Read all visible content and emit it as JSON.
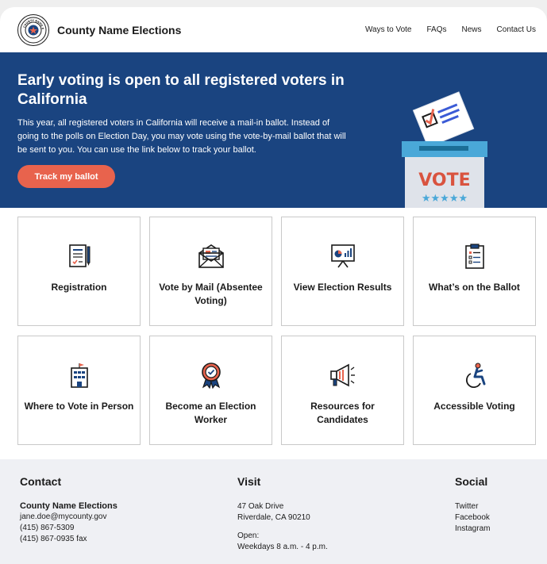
{
  "header": {
    "seal_text": "COUNTY NAME ELECTIONS",
    "title": "County Name Elections",
    "nav": [
      "Ways to Vote",
      "FAQs",
      "News",
      "Contact Us"
    ]
  },
  "hero": {
    "heading": "Early voting is open to all registered voters in California",
    "body": "This year, all registered voters in California will receive a mail-in ballot. Instead of going to the polls on Election Day, you may vote using the vote-by-mail ballot that will be sent to you. You can use the link below to track your ballot.",
    "button": "Track my ballot",
    "vote_text": "VOTE",
    "stars": "★★★★★"
  },
  "cards": [
    {
      "label": "Registration",
      "icon": "registration-form-icon"
    },
    {
      "label": "Vote by Mail (Absentee Voting)",
      "icon": "envelope-icon"
    },
    {
      "label": "View Election Results",
      "icon": "presentation-chart-icon"
    },
    {
      "label": "What’s on the Ballot",
      "icon": "clipboard-icon"
    },
    {
      "label": "Where to Vote in Person",
      "icon": "building-icon"
    },
    {
      "label": "Become an Election Worker",
      "icon": "award-ribbon-icon"
    },
    {
      "label": "Resources for Candidates",
      "icon": "megaphone-icon"
    },
    {
      "label": "Accessible Voting",
      "icon": "wheelchair-icon"
    }
  ],
  "footer": {
    "contact": {
      "heading": "Contact",
      "name": "County Name Elections",
      "email": "jane.doe@mycounty.gov",
      "phone": "(415) 867-5309",
      "fax": "(415) 867-0935 fax"
    },
    "visit": {
      "heading": "Visit",
      "address1": "47 Oak Drive",
      "address2": "Riverdale, CA 90210",
      "open_label": "Open:",
      "hours": "Weekdays 8 a.m. - 4 p.m."
    },
    "social": {
      "heading": "Social",
      "links": [
        "Twitter",
        "Facebook",
        "Instagram"
      ]
    }
  },
  "colors": {
    "hero_bg": "#1a4480",
    "button": "#e8634d",
    "footer_bg": "#eff0f4",
    "icon_blue": "#1a4480",
    "icon_red": "#e8634d"
  }
}
